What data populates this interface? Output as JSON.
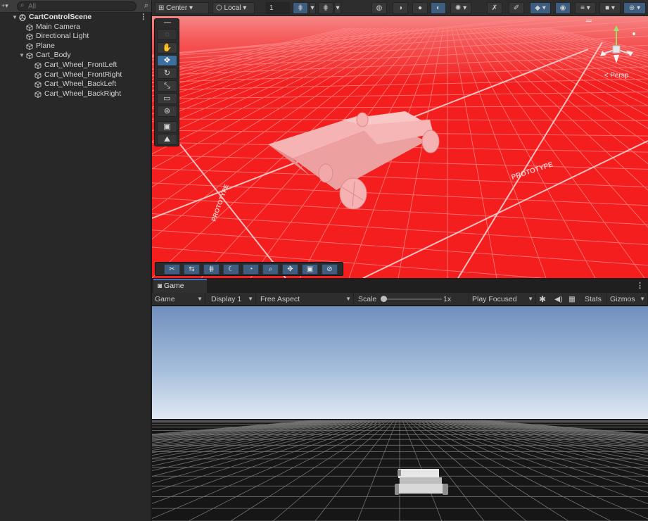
{
  "hierarchy": {
    "search": {
      "placeholder": "All"
    },
    "scene_name": "CartControlScene",
    "items": [
      {
        "label": "Main Camera",
        "depth": 1,
        "icon": "gameobject-cube-icon"
      },
      {
        "label": "Directional Light",
        "depth": 1,
        "icon": "gameobject-cube-icon"
      },
      {
        "label": "Plane",
        "depth": 1,
        "icon": "gameobject-cube-icon"
      },
      {
        "label": "Cart_Body",
        "depth": 1,
        "icon": "gameobject-cube-icon",
        "expanded": true
      },
      {
        "label": "Cart_Wheel_FrontLeft",
        "depth": 2,
        "icon": "gameobject-cube-icon"
      },
      {
        "label": "Cart_Wheel_FrontRight",
        "depth": 2,
        "icon": "gameobject-cube-icon"
      },
      {
        "label": "Cart_Wheel_BackLeft",
        "depth": 2,
        "icon": "gameobject-cube-icon"
      },
      {
        "label": "Cart_Wheel_BackRight",
        "depth": 2,
        "icon": "gameobject-cube-icon"
      }
    ]
  },
  "scene_toolbar": {
    "pivot_mode": "Center",
    "pivot_rotation": "Local",
    "grid_snap_value": "1",
    "tools": [
      "view-tool",
      "move-tool",
      "rotate-tool",
      "scale-tool",
      "rect-tool",
      "transform-tool"
    ],
    "active_tool": "move-tool",
    "overlay_tools": [
      "edit-collider-icon",
      "navigation-icon",
      "grid-icon",
      "moon-icon",
      "orbit-icon",
      "search-icon",
      "move-icon",
      "camera-icon",
      "compass-icon"
    ]
  },
  "scene_view": {
    "perspective_label": "< Persp",
    "background_color": "#f41e1e",
    "grid_decal_text": "PROTOTYPE"
  },
  "game_view": {
    "tab_label": "Game",
    "mode": "Game",
    "display": "Display 1",
    "aspect": "Free Aspect",
    "scale_label": "Scale",
    "scale_value": "1x",
    "play_mode": "Play Focused",
    "stats_label": "Stats",
    "gizmos_label": "Gizmos"
  },
  "colors": {
    "accent": "#3a79bb",
    "panel": "#282828",
    "toolbar": "#2d2d2d",
    "sky_top": "#6f8fbd",
    "ground": "#161616"
  }
}
